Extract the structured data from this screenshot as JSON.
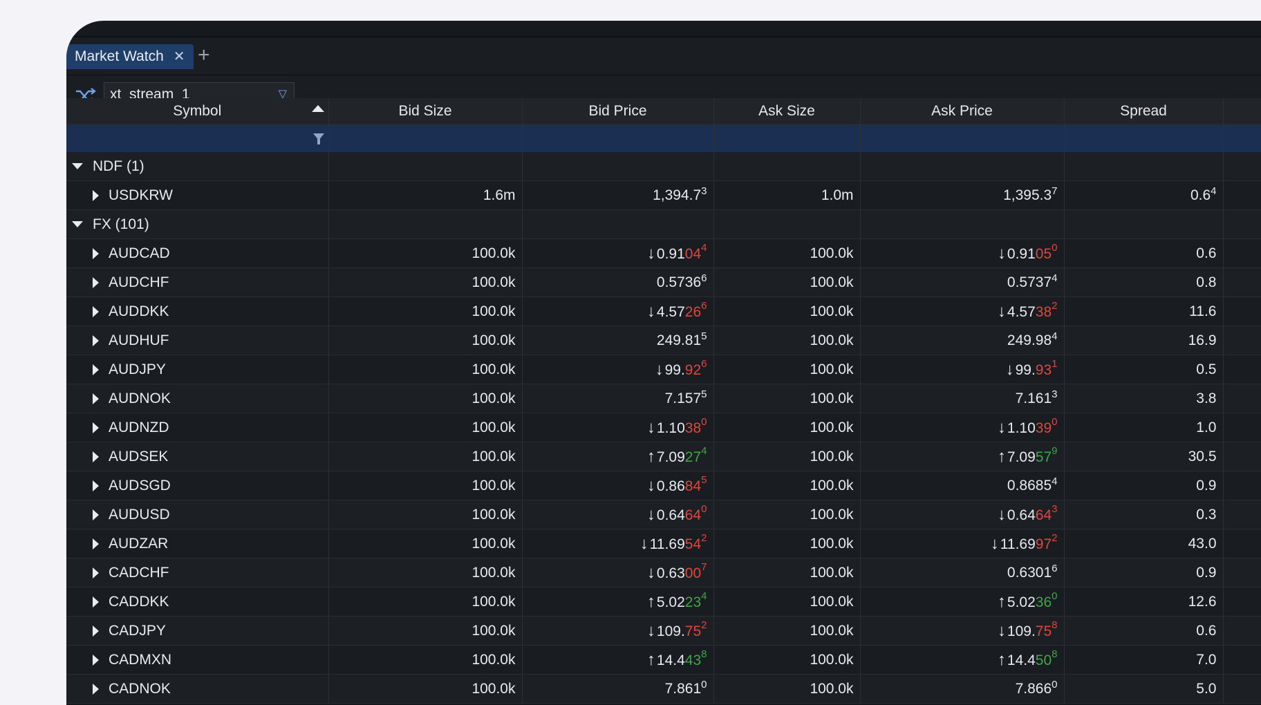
{
  "tab": {
    "title": "Market Watch"
  },
  "toolbar": {
    "stream": "xt_stream_1"
  },
  "columns": [
    "Symbol",
    "Bid Size",
    "Bid Price",
    "Ask Size",
    "Ask Price",
    "Spread"
  ],
  "colors": {
    "down": "#e0473f",
    "up": "#3fa64a",
    "header_filter": "#1b2f52",
    "tab": "#1f3f6a"
  },
  "rows": [
    {
      "type": "group",
      "label": "NDF (1)"
    },
    {
      "type": "item",
      "symbol": "USDKRW",
      "bid_size": "1.6m",
      "bid": {
        "dir": "",
        "main": "1,394.7",
        "hl": "",
        "sup": "3"
      },
      "ask_size": "1.0m",
      "ask": {
        "dir": "",
        "main": "1,395.3",
        "hl": "",
        "sup": "7"
      },
      "spread": {
        "main": "0.6",
        "sup": "4"
      }
    },
    {
      "type": "group",
      "label": "FX (101)"
    },
    {
      "type": "item",
      "symbol": "AUDCAD",
      "bid_size": "100.0k",
      "bid": {
        "dir": "down",
        "main": "0.91",
        "hl": "04",
        "sup": "4"
      },
      "ask_size": "100.0k",
      "ask": {
        "dir": "down",
        "main": "0.91",
        "hl": "05",
        "sup": "0"
      },
      "spread": {
        "main": "0.6",
        "sup": ""
      }
    },
    {
      "type": "item",
      "symbol": "AUDCHF",
      "bid_size": "100.0k",
      "bid": {
        "dir": "",
        "main": "0.5736",
        "hl": "",
        "sup": "6"
      },
      "ask_size": "100.0k",
      "ask": {
        "dir": "",
        "main": "0.5737",
        "hl": "",
        "sup": "4"
      },
      "spread": {
        "main": "0.8",
        "sup": ""
      }
    },
    {
      "type": "item",
      "symbol": "AUDDKK",
      "bid_size": "100.0k",
      "bid": {
        "dir": "down",
        "main": "4.57",
        "hl": "26",
        "sup": "6"
      },
      "ask_size": "100.0k",
      "ask": {
        "dir": "down",
        "main": "4.57",
        "hl": "38",
        "sup": "2"
      },
      "spread": {
        "main": "11.6",
        "sup": ""
      }
    },
    {
      "type": "item",
      "symbol": "AUDHUF",
      "bid_size": "100.0k",
      "bid": {
        "dir": "",
        "main": "249.81",
        "hl": "",
        "sup": "5"
      },
      "ask_size": "100.0k",
      "ask": {
        "dir": "",
        "main": "249.98",
        "hl": "",
        "sup": "4"
      },
      "spread": {
        "main": "16.9",
        "sup": ""
      }
    },
    {
      "type": "item",
      "symbol": "AUDJPY",
      "bid_size": "100.0k",
      "bid": {
        "dir": "down",
        "main": "99.",
        "hl": "92",
        "sup": "6"
      },
      "ask_size": "100.0k",
      "ask": {
        "dir": "down",
        "main": "99.",
        "hl": "93",
        "sup": "1"
      },
      "spread": {
        "main": "0.5",
        "sup": ""
      }
    },
    {
      "type": "item",
      "symbol": "AUDNOK",
      "bid_size": "100.0k",
      "bid": {
        "dir": "",
        "main": "7.157",
        "hl": "",
        "sup": "5"
      },
      "ask_size": "100.0k",
      "ask": {
        "dir": "",
        "main": "7.161",
        "hl": "",
        "sup": "3"
      },
      "spread": {
        "main": "3.8",
        "sup": ""
      }
    },
    {
      "type": "item",
      "symbol": "AUDNZD",
      "bid_size": "100.0k",
      "bid": {
        "dir": "down",
        "main": "1.10",
        "hl": "38",
        "sup": "0"
      },
      "ask_size": "100.0k",
      "ask": {
        "dir": "down",
        "main": "1.10",
        "hl": "39",
        "sup": "0"
      },
      "spread": {
        "main": "1.0",
        "sup": ""
      }
    },
    {
      "type": "item",
      "symbol": "AUDSEK",
      "bid_size": "100.0k",
      "bid": {
        "dir": "up",
        "main": "7.09",
        "hl": "27",
        "sup": "4"
      },
      "ask_size": "100.0k",
      "ask": {
        "dir": "up",
        "main": "7.09",
        "hl": "57",
        "sup": "9"
      },
      "spread": {
        "main": "30.5",
        "sup": ""
      }
    },
    {
      "type": "item",
      "symbol": "AUDSGD",
      "bid_size": "100.0k",
      "bid": {
        "dir": "down",
        "main": "0.86",
        "hl": "84",
        "sup": "5"
      },
      "ask_size": "100.0k",
      "ask": {
        "dir": "",
        "main": "0.8685",
        "hl": "",
        "sup": "4"
      },
      "spread": {
        "main": "0.9",
        "sup": ""
      }
    },
    {
      "type": "item",
      "symbol": "AUDUSD",
      "bid_size": "100.0k",
      "bid": {
        "dir": "down",
        "main": "0.64",
        "hl": "64",
        "sup": "0"
      },
      "ask_size": "100.0k",
      "ask": {
        "dir": "down",
        "main": "0.64",
        "hl": "64",
        "sup": "3"
      },
      "spread": {
        "main": "0.3",
        "sup": ""
      }
    },
    {
      "type": "item",
      "symbol": "AUDZAR",
      "bid_size": "100.0k",
      "bid": {
        "dir": "down",
        "main": "11.69",
        "hl": "54",
        "sup": "2"
      },
      "ask_size": "100.0k",
      "ask": {
        "dir": "down",
        "main": "11.69",
        "hl": "97",
        "sup": "2"
      },
      "spread": {
        "main": "43.0",
        "sup": ""
      }
    },
    {
      "type": "item",
      "symbol": "CADCHF",
      "bid_size": "100.0k",
      "bid": {
        "dir": "down",
        "main": "0.63",
        "hl": "00",
        "sup": "7"
      },
      "ask_size": "100.0k",
      "ask": {
        "dir": "",
        "main": "0.6301",
        "hl": "",
        "sup": "6"
      },
      "spread": {
        "main": "0.9",
        "sup": ""
      }
    },
    {
      "type": "item",
      "symbol": "CADDKK",
      "bid_size": "100.0k",
      "bid": {
        "dir": "up",
        "main": "5.02",
        "hl": "23",
        "sup": "4"
      },
      "ask_size": "100.0k",
      "ask": {
        "dir": "up",
        "main": "5.02",
        "hl": "36",
        "sup": "0"
      },
      "spread": {
        "main": "12.6",
        "sup": ""
      }
    },
    {
      "type": "item",
      "symbol": "CADJPY",
      "bid_size": "100.0k",
      "bid": {
        "dir": "down",
        "main": "109.",
        "hl": "75",
        "sup": "2"
      },
      "ask_size": "100.0k",
      "ask": {
        "dir": "down",
        "main": "109.",
        "hl": "75",
        "sup": "8"
      },
      "spread": {
        "main": "0.6",
        "sup": ""
      }
    },
    {
      "type": "item",
      "symbol": "CADMXN",
      "bid_size": "100.0k",
      "bid": {
        "dir": "up",
        "main": "14.4",
        "hl": "43",
        "sup": "8"
      },
      "ask_size": "100.0k",
      "ask": {
        "dir": "up",
        "main": "14.4",
        "hl": "50",
        "sup": "8"
      },
      "spread": {
        "main": "7.0",
        "sup": ""
      }
    },
    {
      "type": "item",
      "symbol": "CADNOK",
      "bid_size": "100.0k",
      "bid": {
        "dir": "",
        "main": "7.861",
        "hl": "",
        "sup": "0"
      },
      "ask_size": "100.0k",
      "ask": {
        "dir": "",
        "main": "7.866",
        "hl": "",
        "sup": "0"
      },
      "spread": {
        "main": "5.0",
        "sup": ""
      }
    }
  ]
}
